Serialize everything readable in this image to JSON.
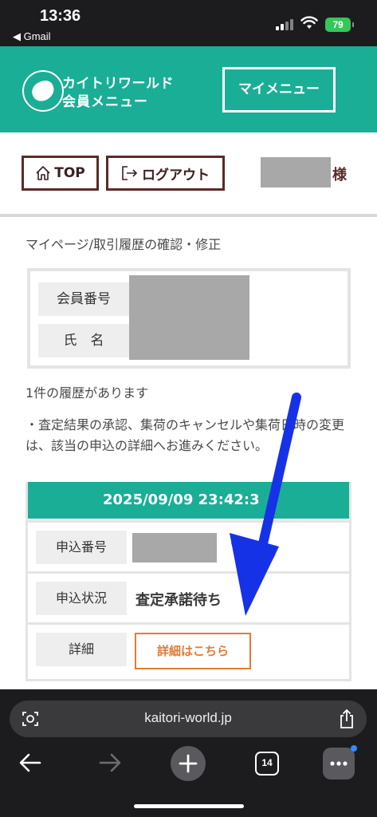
{
  "status_bar": {
    "time": "13:36",
    "back_app": "◀ Gmail",
    "battery": "79"
  },
  "header": {
    "logo_line1": "カイトリワールド",
    "logo_line2": "会員メニュー",
    "my_menu": "マイメニュー",
    "brand_color": "#1aae96"
  },
  "nav": {
    "top_label": "TOP",
    "logout_label": "ログアウト",
    "name_suffix": "様"
  },
  "breadcrumb": "マイページ/取引履歴の確認・修正",
  "member": {
    "number_label": "会員番号",
    "name_label": "氏　名"
  },
  "history_count": "1件の履歴があります",
  "notice": "・査定結果の承認、集荷のキャンセルや集荷日時の変更は、該当の申込の詳細へお進みください。",
  "history": {
    "datetime": "2025/09/09 23:42:3",
    "application_number_label": "申込番号",
    "status_label": "申込状況",
    "status_value": "査定承諾待ち",
    "detail_label": "詳細",
    "detail_button": "詳細はこちら",
    "accent_color": "#e07b39"
  },
  "browser": {
    "url": "kaitori-world.jp",
    "tab_count": "14"
  }
}
